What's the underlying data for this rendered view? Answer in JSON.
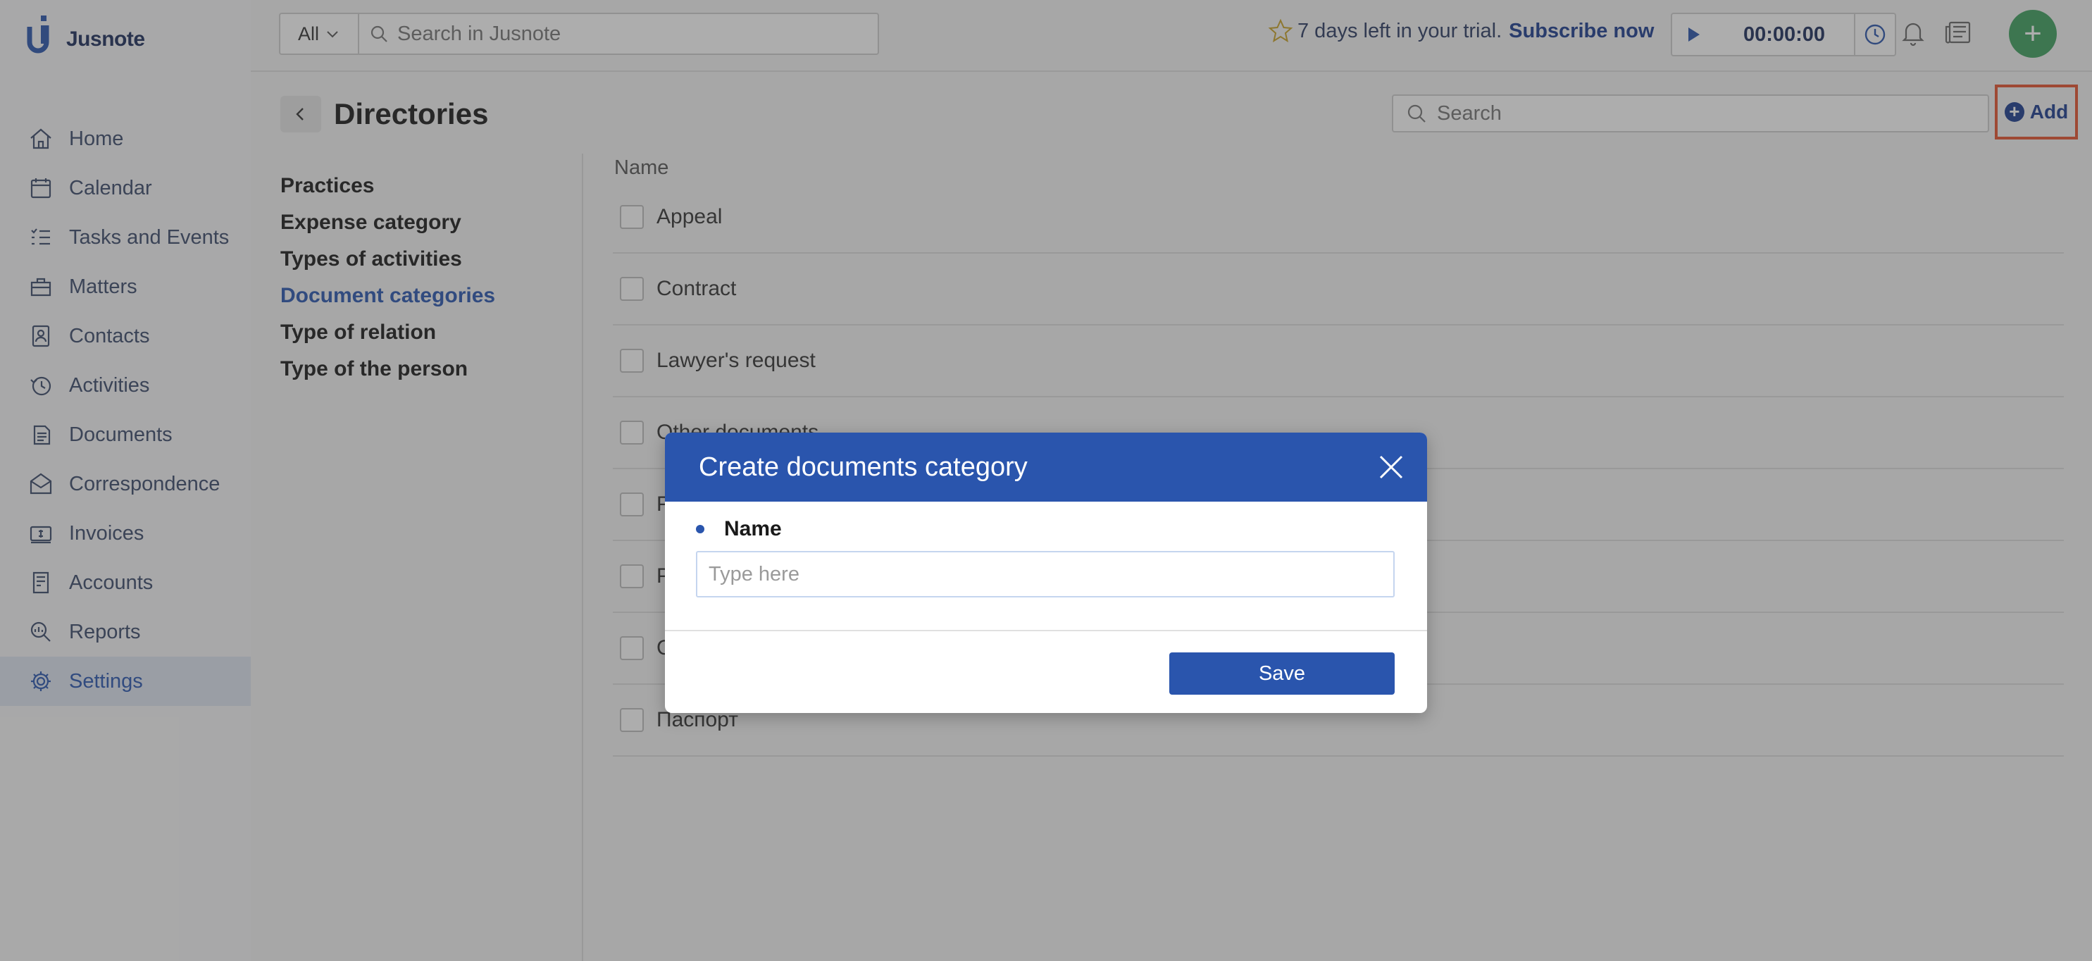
{
  "brand": {
    "name": "Jusnote"
  },
  "sidebar": {
    "items": [
      {
        "label": "Home",
        "icon": "home-icon"
      },
      {
        "label": "Calendar",
        "icon": "calendar-icon"
      },
      {
        "label": "Tasks and Events",
        "icon": "tasks-icon"
      },
      {
        "label": "Matters",
        "icon": "matters-icon"
      },
      {
        "label": "Contacts",
        "icon": "contacts-icon"
      },
      {
        "label": "Activities",
        "icon": "activities-icon"
      },
      {
        "label": "Documents",
        "icon": "documents-icon"
      },
      {
        "label": "Correspondence",
        "icon": "correspondence-icon"
      },
      {
        "label": "Invoices",
        "icon": "invoices-icon"
      },
      {
        "label": "Accounts",
        "icon": "accounts-icon"
      },
      {
        "label": "Reports",
        "icon": "reports-icon"
      },
      {
        "label": "Settings",
        "icon": "settings-icon",
        "active": true
      }
    ]
  },
  "header": {
    "search_scope": "All",
    "search_placeholder": "Search in Jusnote",
    "trial_text": "7 days left in your trial.",
    "subscribe_label": "Subscribe now",
    "timer_value": "00:00:00"
  },
  "page": {
    "title": "Directories",
    "search_placeholder": "Search",
    "add_label": "Add"
  },
  "directories": [
    {
      "label": "Practices"
    },
    {
      "label": "Expense category"
    },
    {
      "label": "Types of activities"
    },
    {
      "label": "Document categories",
      "active": true
    },
    {
      "label": "Type of relation"
    },
    {
      "label": "Type of the person"
    }
  ],
  "table": {
    "column_name": "Name",
    "rows": [
      "Appeal",
      "Contract",
      "Lawyer's request",
      "Other documents",
      "P",
      "P",
      "C",
      "Паспорт"
    ]
  },
  "modal": {
    "title": "Create documents category",
    "field_label": "Name",
    "field_placeholder": "Type here",
    "field_value": "",
    "save_label": "Save"
  },
  "colors": {
    "accent": "#2a55ad",
    "active_nav": "#2a56b0",
    "highlight_border": "#e5532f",
    "plus_button": "#3fa160"
  }
}
